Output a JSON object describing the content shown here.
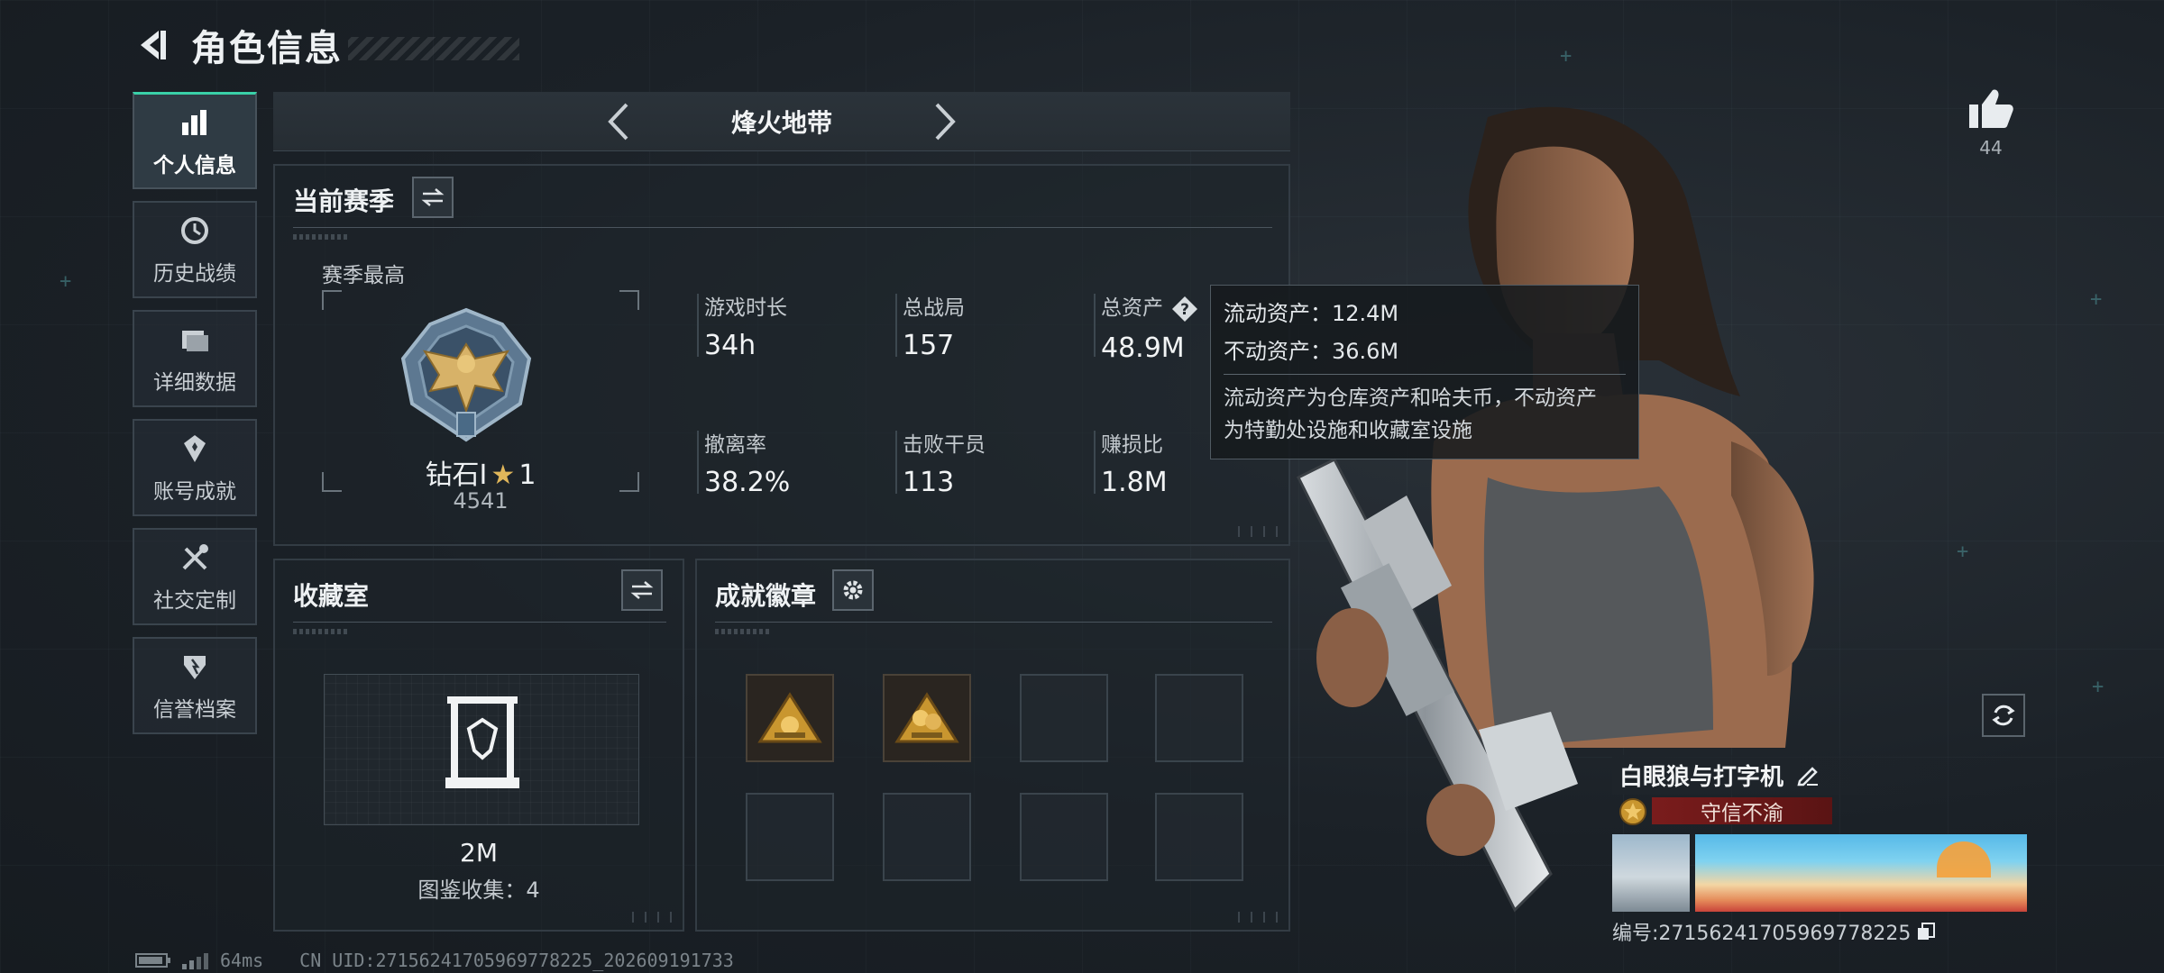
{
  "header": {
    "title": "角色信息",
    "back_icon": "back-arrow-icon"
  },
  "nav": {
    "items": [
      {
        "label": "个人信息",
        "icon": "bar-chart-icon",
        "active": true
      },
      {
        "label": "历史战绩",
        "icon": "history-icon",
        "active": false
      },
      {
        "label": "详细数据",
        "icon": "folder-icon",
        "active": false
      },
      {
        "label": "账号成就",
        "icon": "achievement-icon",
        "active": false
      },
      {
        "label": "社交定制",
        "icon": "tools-icon",
        "active": false
      },
      {
        "label": "信誉档案",
        "icon": "shield-icon",
        "active": false
      }
    ]
  },
  "mode": {
    "title": "烽火地带"
  },
  "season": {
    "title": "当前赛季",
    "best_label": "赛季最高",
    "rank_name": "钻石Ⅰ",
    "rank_stars": "1",
    "rank_score": "4541",
    "stats": [
      {
        "label": "游戏时长",
        "value": "34h"
      },
      {
        "label": "总战局",
        "value": "157"
      },
      {
        "label": "总资产",
        "value": "48.9M"
      },
      {
        "label": "撤离率",
        "value": "38.2%"
      },
      {
        "label": "击败干员",
        "value": "113"
      },
      {
        "label": "赚损比",
        "value": "1.8M"
      }
    ]
  },
  "tooltip": {
    "liquid": "流动资产：12.4M",
    "fixed": "不动资产：36.6M",
    "desc_line1": "流动资产为仓库资产和哈夫币，不动资产",
    "desc_line2": "为特勤处设施和收藏室设施"
  },
  "collection": {
    "title": "收藏室",
    "value": "2M",
    "count": "图鉴收集：4"
  },
  "badges": {
    "title": "成就徽章",
    "filled_slots": 2,
    "total_slots": 8
  },
  "like": {
    "count": "44"
  },
  "player": {
    "name": "白眼狼与打字机",
    "title_tag": "守信不渝",
    "id_text": "编号:2715624170596977822​5"
  },
  "status": {
    "ping": "64ms",
    "uid": "CN UID:2715624170596977822​5_202609191733"
  },
  "colors": {
    "accent": "#39d0a8",
    "gold": "#e0b65a",
    "title_red": "#7a1c1c"
  }
}
